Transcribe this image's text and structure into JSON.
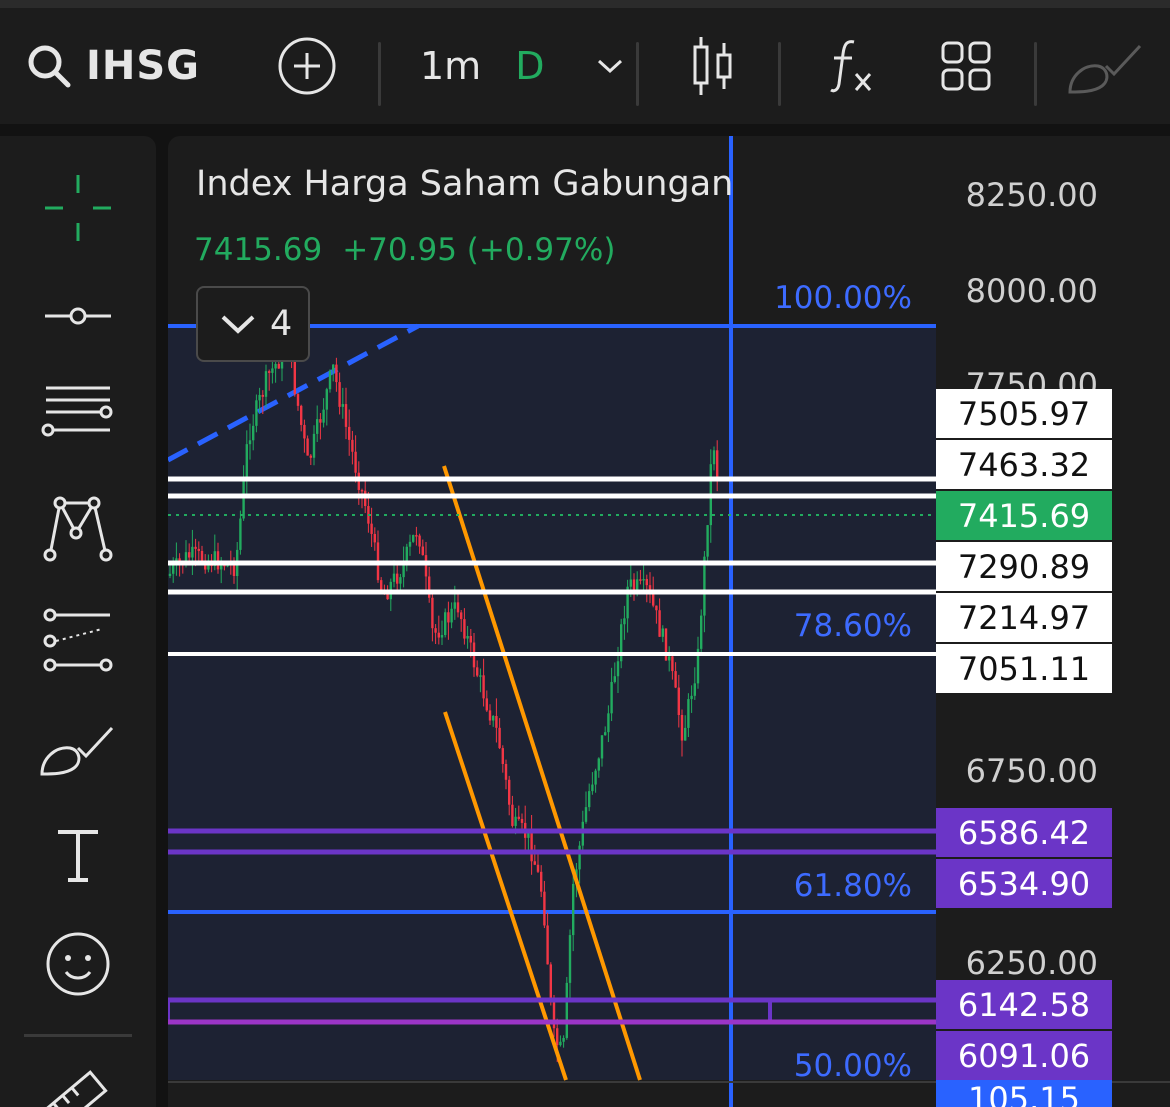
{
  "toolbar": {
    "symbol": "IHSG",
    "interval": "1m",
    "interval_unit": "D",
    "icons": [
      "search-icon",
      "add-circle-icon",
      "chevron-down-icon",
      "candles-icon",
      "function-fx-icon",
      "layouts-grid-icon",
      "brush-icon"
    ]
  },
  "left_tools": [
    "crosshair-icon",
    "horizontal-line-icon",
    "horizontal-rays-icon",
    "pattern-icon",
    "channel-icon",
    "brush-icon",
    "text-icon",
    "emoji-icon",
    "ruler-icon"
  ],
  "chart": {
    "title": "Index Harga Saham Gabungan",
    "last_price": "7415.69",
    "change": "+70.95 (+0.97%)",
    "indicators_count": "4",
    "axis_labels": [
      "8250.00",
      "8000.00",
      "7750.00",
      "6750.00",
      "6250.00"
    ],
    "fib_levels": [
      "100.00%",
      "78.60%",
      "61.80%",
      "50.00%"
    ],
    "white_tags": [
      "7505.97",
      "7463.32",
      "7290.89",
      "7214.97",
      "7051.11"
    ],
    "current_tag": "7415.69",
    "purple_tags": [
      "6586.42",
      "6534.90",
      "6142.58",
      "6091.06"
    ],
    "cut_tag": "105.15",
    "colors": {
      "up": "#22ab5f",
      "down": "#f23645",
      "fib": "#2962ff",
      "channel": "#ff9800",
      "support": "#6b35c7",
      "resistance": "#ffffff",
      "background": "#1c1c1c"
    }
  }
}
